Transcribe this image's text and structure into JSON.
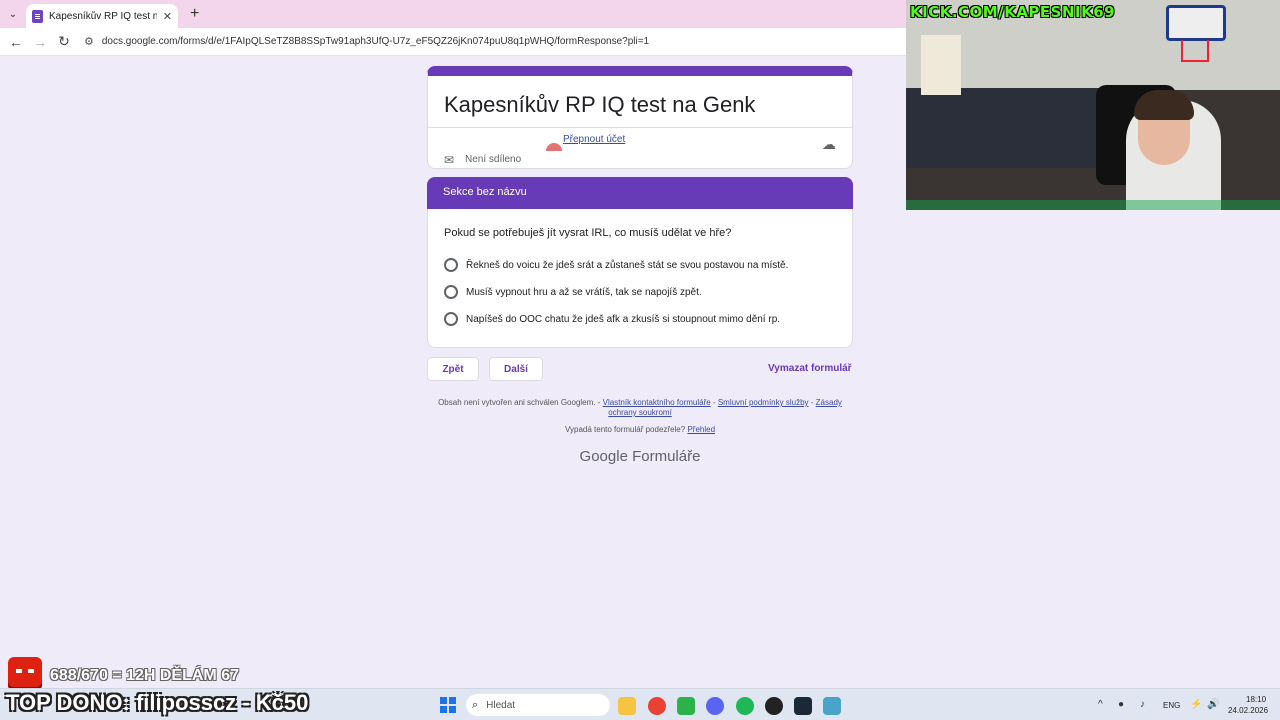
{
  "browser": {
    "tab_title": "Kapesníkův RP IQ test na Genk",
    "tab_close": "✕",
    "new_tab": "+",
    "url": "docs.google.com/forms/d/e/1FAIpQLSeTZ8B8SSpTw91aph3UfQ-U7z_eF5QZ26jKn074puU8q1pWHQ/formResponse?pli=1"
  },
  "form": {
    "title": "Kapesníkův RP IQ test na Genk",
    "switch_account": "Přepnout účet",
    "not_shared": "Není sdíleno",
    "section_title": "Sekce bez názvu",
    "question": "Pokud se potřebuješ jít vysrat IRL, co musíš udělat ve hře?",
    "options": [
      "Řekneš do voicu že jdeš srát a zůstaneš stát se svou postavou na místě.",
      "Musíš vypnout hru a až se vrátíš, tak se napojíš zpět.",
      "Napíšeš do OOC chatu že jdeš afk a zkusíš si stoupnout mimo dění rp."
    ],
    "back_label": "Zpět",
    "next_label": "Další",
    "clear_label": "Vymazat formulář",
    "footer_text": "Obsah není vytvořen ani schválen Googlem. -",
    "footer_link1": "Vlastník kontaktního formuláře",
    "footer_sep1": "-",
    "footer_link2": "Smluvní podmínky služby",
    "footer_sep2": "-",
    "footer_link3": "Zásady ochrany soukromí",
    "suspicious_text": "Vypadá tento formulář podezřele?",
    "suspicious_link": "Přehled",
    "brand_google": "Google",
    "brand_forms": "Formuláře"
  },
  "stream": {
    "kick": "KICK.COM/KAPESNIK69",
    "goal": "688/670 = 12H DĚLÁM 67",
    "top_dono": "TOP DONO: filiposscz - Kč50"
  },
  "taskbar": {
    "search_placeholder": "Hledat",
    "lang": "ENG",
    "time": "18:10",
    "date": "24.02.2026"
  },
  "colors": {
    "accent": "#673ab7",
    "background": "#f0ebf8"
  }
}
